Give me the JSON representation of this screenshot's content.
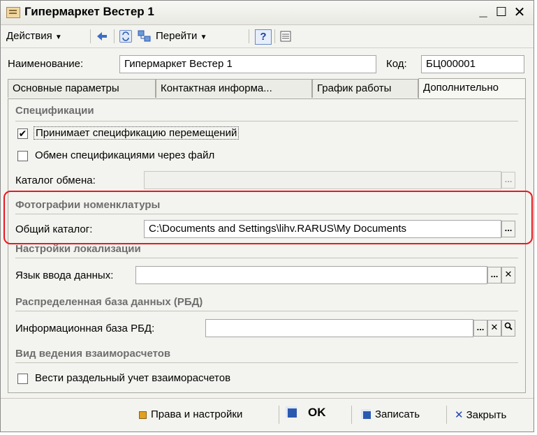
{
  "window": {
    "title": "Гипермаркет Вестер 1"
  },
  "toolbar": {
    "actions_label": "Действия",
    "goto_label": "Перейти",
    "help_label": "?"
  },
  "header": {
    "name_label": "Наименование:",
    "name_value": "Гипермаркет Вестер 1",
    "code_label": "Код:",
    "code_value": "БЦ000001"
  },
  "tabs": [
    {
      "label": "Основные параметры"
    },
    {
      "label": "Контактная информа..."
    },
    {
      "label": "График работы"
    },
    {
      "label": "Дополнительно"
    }
  ],
  "specs": {
    "title": "Спецификации",
    "accept_label": "Принимает спецификацию перемещений",
    "accept_checked": true,
    "exchange_label": "Обмен спецификациями через файл",
    "exchange_checked": false,
    "catalog_label": "Каталог обмена:",
    "catalog_value": ""
  },
  "photos": {
    "title": "Фотографии номенклатуры",
    "common_label": "Общий каталог:",
    "common_value": "C:\\Documents and Settings\\lihv.RARUS\\My Documents"
  },
  "localization": {
    "title": "Настройки локализации",
    "lang_label": "Язык ввода данных:",
    "lang_value": ""
  },
  "rbd": {
    "title": "Распределенная база данных (РБД)",
    "base_label": "Информационная база РБД:",
    "base_value": ""
  },
  "settlements": {
    "title": "Вид ведения взаиморасчетов",
    "separate_label": "Вести раздельный учет взаиморасчетов",
    "separate_checked": false
  },
  "footer": {
    "rights_label": "Права и настройки",
    "ok_label": "OK",
    "save_label": "Записать",
    "close_label": "Закрыть"
  },
  "colors": {
    "highlight": "#e8191f"
  }
}
